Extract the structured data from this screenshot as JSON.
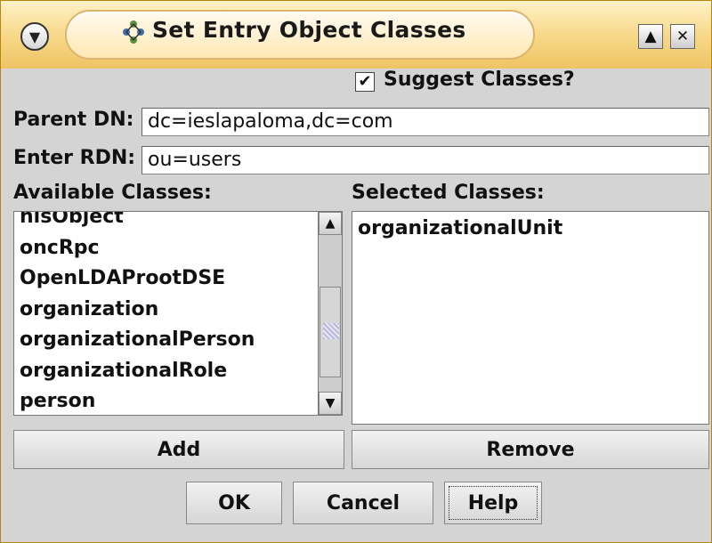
{
  "window": {
    "title": "Set Entry Object Classes",
    "menu_icon": "chevron-down-icon",
    "title_icon": "ldap-browser-icon",
    "maximize_icon": "maximize-icon",
    "close_icon": "close-icon"
  },
  "suggest": {
    "label": "Suggest Classes?",
    "checked": true
  },
  "parent_dn": {
    "label": "Parent DN:",
    "value": "dc=ieslapaloma,dc=com"
  },
  "rdn": {
    "label": "Enter RDN:",
    "value": "ou=users"
  },
  "available": {
    "label": "Available Classes:",
    "items": [
      "nisObject",
      "oncRpc",
      "OpenLDAProotDSE",
      "organization",
      "organizationalPerson",
      "organizationalRole",
      "person"
    ]
  },
  "selected": {
    "label": "Selected Classes:",
    "items": [
      "organizationalUnit"
    ]
  },
  "buttons": {
    "add": "Add",
    "remove": "Remove",
    "ok": "OK",
    "cancel": "Cancel",
    "help": "Help"
  }
}
